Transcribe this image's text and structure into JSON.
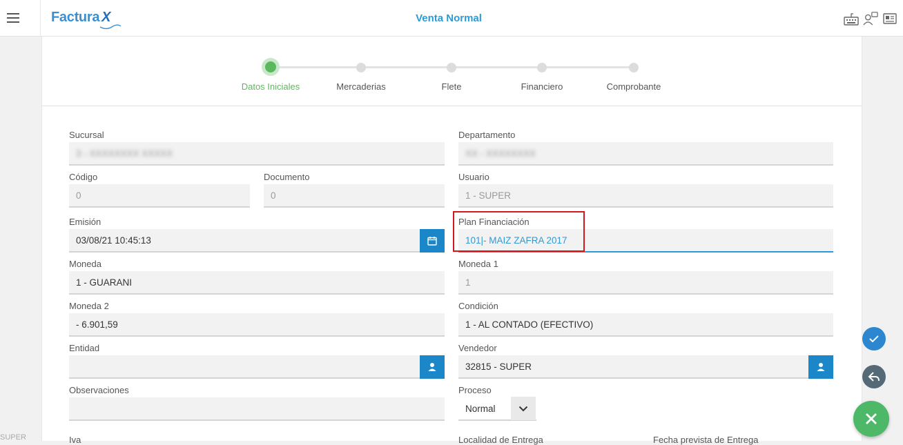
{
  "app": {
    "logo_text": "Factura",
    "logo_x": "X",
    "title": "Venta Normal"
  },
  "steps": [
    {
      "label": "Datos Iniciales",
      "active": true
    },
    {
      "label": "Mercaderias",
      "active": false
    },
    {
      "label": "Flete",
      "active": false
    },
    {
      "label": "Financiero",
      "active": false
    },
    {
      "label": "Comprobante",
      "active": false
    }
  ],
  "form": {
    "sucursal": {
      "label": "Sucursal",
      "value": "3 - XXXXXXXX XXXXX"
    },
    "departamento": {
      "label": "Departamento",
      "value": "XX - XXXXXXXX"
    },
    "codigo": {
      "label": "Código",
      "value": "0"
    },
    "documento": {
      "label": "Documento",
      "value": "0"
    },
    "usuario": {
      "label": "Usuario",
      "value": "1 - SUPER"
    },
    "emision": {
      "label": "Emisión",
      "value": "03/08/21 10:45:13"
    },
    "plan": {
      "label": "Plan Financiación",
      "value": "101|- MAIZ ZAFRA 2017"
    },
    "moneda": {
      "label": "Moneda",
      "value": "1 - GUARANI"
    },
    "moneda1": {
      "label": "Moneda 1",
      "value": "1"
    },
    "moneda2": {
      "label": "Moneda 2",
      "value": "- 6.901,59"
    },
    "condicion": {
      "label": "Condición",
      "value": "1 - AL CONTADO (EFECTIVO)"
    },
    "entidad": {
      "label": "Entidad",
      "value": ""
    },
    "vendedor": {
      "label": "Vendedor",
      "value": "32815 - SUPER"
    },
    "observaciones": {
      "label": "Observaciones",
      "value": ""
    },
    "proceso": {
      "label": "Proceso",
      "value": "Normal"
    },
    "iva": {
      "label": "Iva"
    },
    "localidad": {
      "label": "Localidad de Entrega"
    },
    "fecha_entrega": {
      "label": "Fecha prevista de Entrega"
    }
  },
  "side_user": "SUPER",
  "colors": {
    "accent": "#2d9ad8",
    "step_active": "#5cb85c",
    "fab_close": "#4cb868",
    "highlight": "#d0191f"
  }
}
